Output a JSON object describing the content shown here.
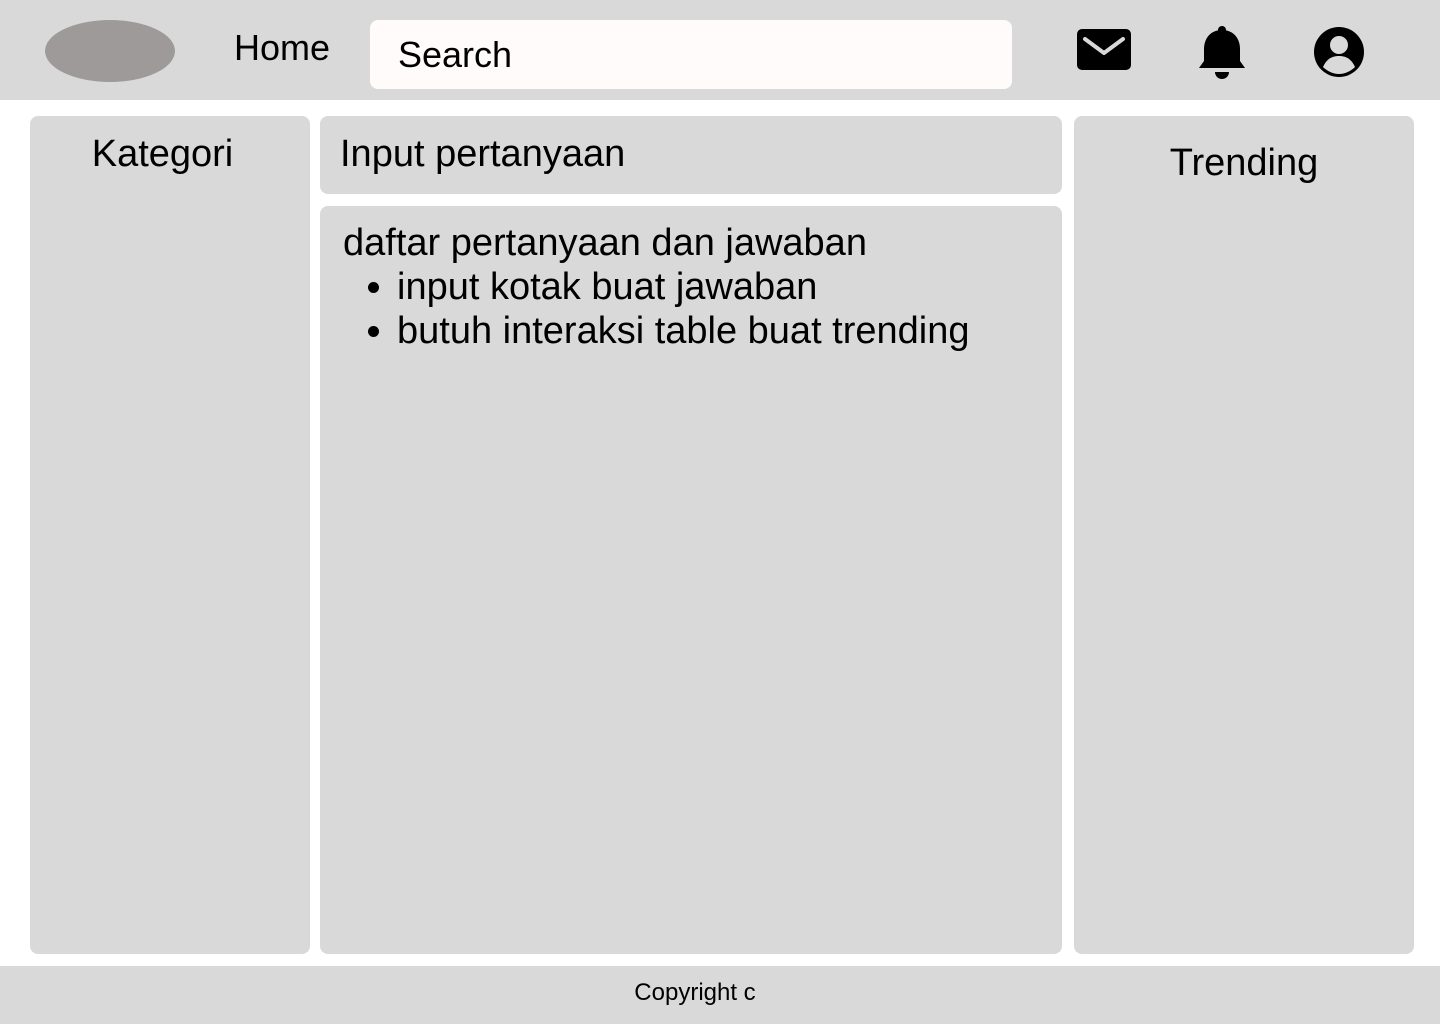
{
  "header": {
    "home_label": "Home",
    "search_placeholder": "Search",
    "icons": [
      "logo",
      "mail-icon",
      "bell-icon",
      "user-icon"
    ]
  },
  "sidebar": {
    "title": "Kategori"
  },
  "main": {
    "question_input_label": "Input pertanyaan",
    "qa_title": "daftar pertanyaan dan jawaban",
    "qa_notes": [
      "input kotak buat jawaban",
      "butuh interaksi table buat trending"
    ]
  },
  "trending": {
    "title": "Trending"
  },
  "footer": {
    "copyright": "Copyright c"
  },
  "colors": {
    "panel_bg": "#d9d9d9",
    "logo": "#9e9a9a",
    "search_bg": "#fffbfb",
    "text": "#000000"
  }
}
